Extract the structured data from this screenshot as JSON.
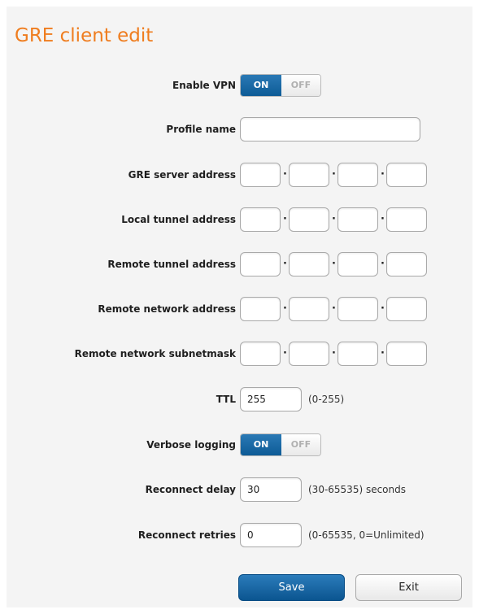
{
  "page": {
    "title": "GRE client edit"
  },
  "form": {
    "enable_vpn": {
      "label": "Enable VPN",
      "on": "ON",
      "off": "OFF",
      "state": "ON"
    },
    "profile_name": {
      "label": "Profile name",
      "value": ""
    },
    "gre_server_address": {
      "label": "GRE server address",
      "octets": [
        "",
        "",
        "",
        ""
      ]
    },
    "local_tunnel_address": {
      "label": "Local tunnel address",
      "octets": [
        "",
        "",
        "",
        ""
      ]
    },
    "remote_tunnel_address": {
      "label": "Remote tunnel address",
      "octets": [
        "",
        "",
        "",
        ""
      ]
    },
    "remote_network_address": {
      "label": "Remote network address",
      "octets": [
        "",
        "",
        "",
        ""
      ]
    },
    "remote_network_subnetmask": {
      "label": "Remote network subnetmask",
      "octets": [
        "",
        "",
        "",
        ""
      ]
    },
    "ttl": {
      "label": "TTL",
      "value": "255",
      "hint": "(0-255)"
    },
    "verbose_logging": {
      "label": "Verbose logging",
      "on": "ON",
      "off": "OFF",
      "state": "ON"
    },
    "reconnect_delay": {
      "label": "Reconnect delay",
      "value": "30",
      "hint": "(30-65535) seconds"
    },
    "reconnect_retries": {
      "label": "Reconnect retries",
      "value": "0",
      "hint": "(0-65535, 0=Unlimited)"
    }
  },
  "buttons": {
    "save": "Save",
    "exit": "Exit"
  },
  "colors": {
    "title": "#ef7d1f",
    "primary": "#0d5b96",
    "panel_bg": "#f4f4f4"
  }
}
